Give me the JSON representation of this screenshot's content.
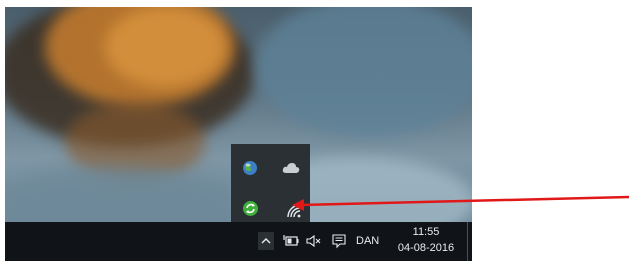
{
  "taskbar": {
    "language": "DAN",
    "clock": {
      "time": "11:55",
      "date": "04-08-2016"
    }
  },
  "tray_popup": {
    "icons": [
      "network-globe-icon",
      "onedrive-cloud-icon",
      "sync-update-icon",
      "wifi-icon"
    ]
  },
  "colors": {
    "annotation_arrow": "#e01818",
    "taskbar_bg": "#101418",
    "popup_bg": "#2b3035"
  }
}
